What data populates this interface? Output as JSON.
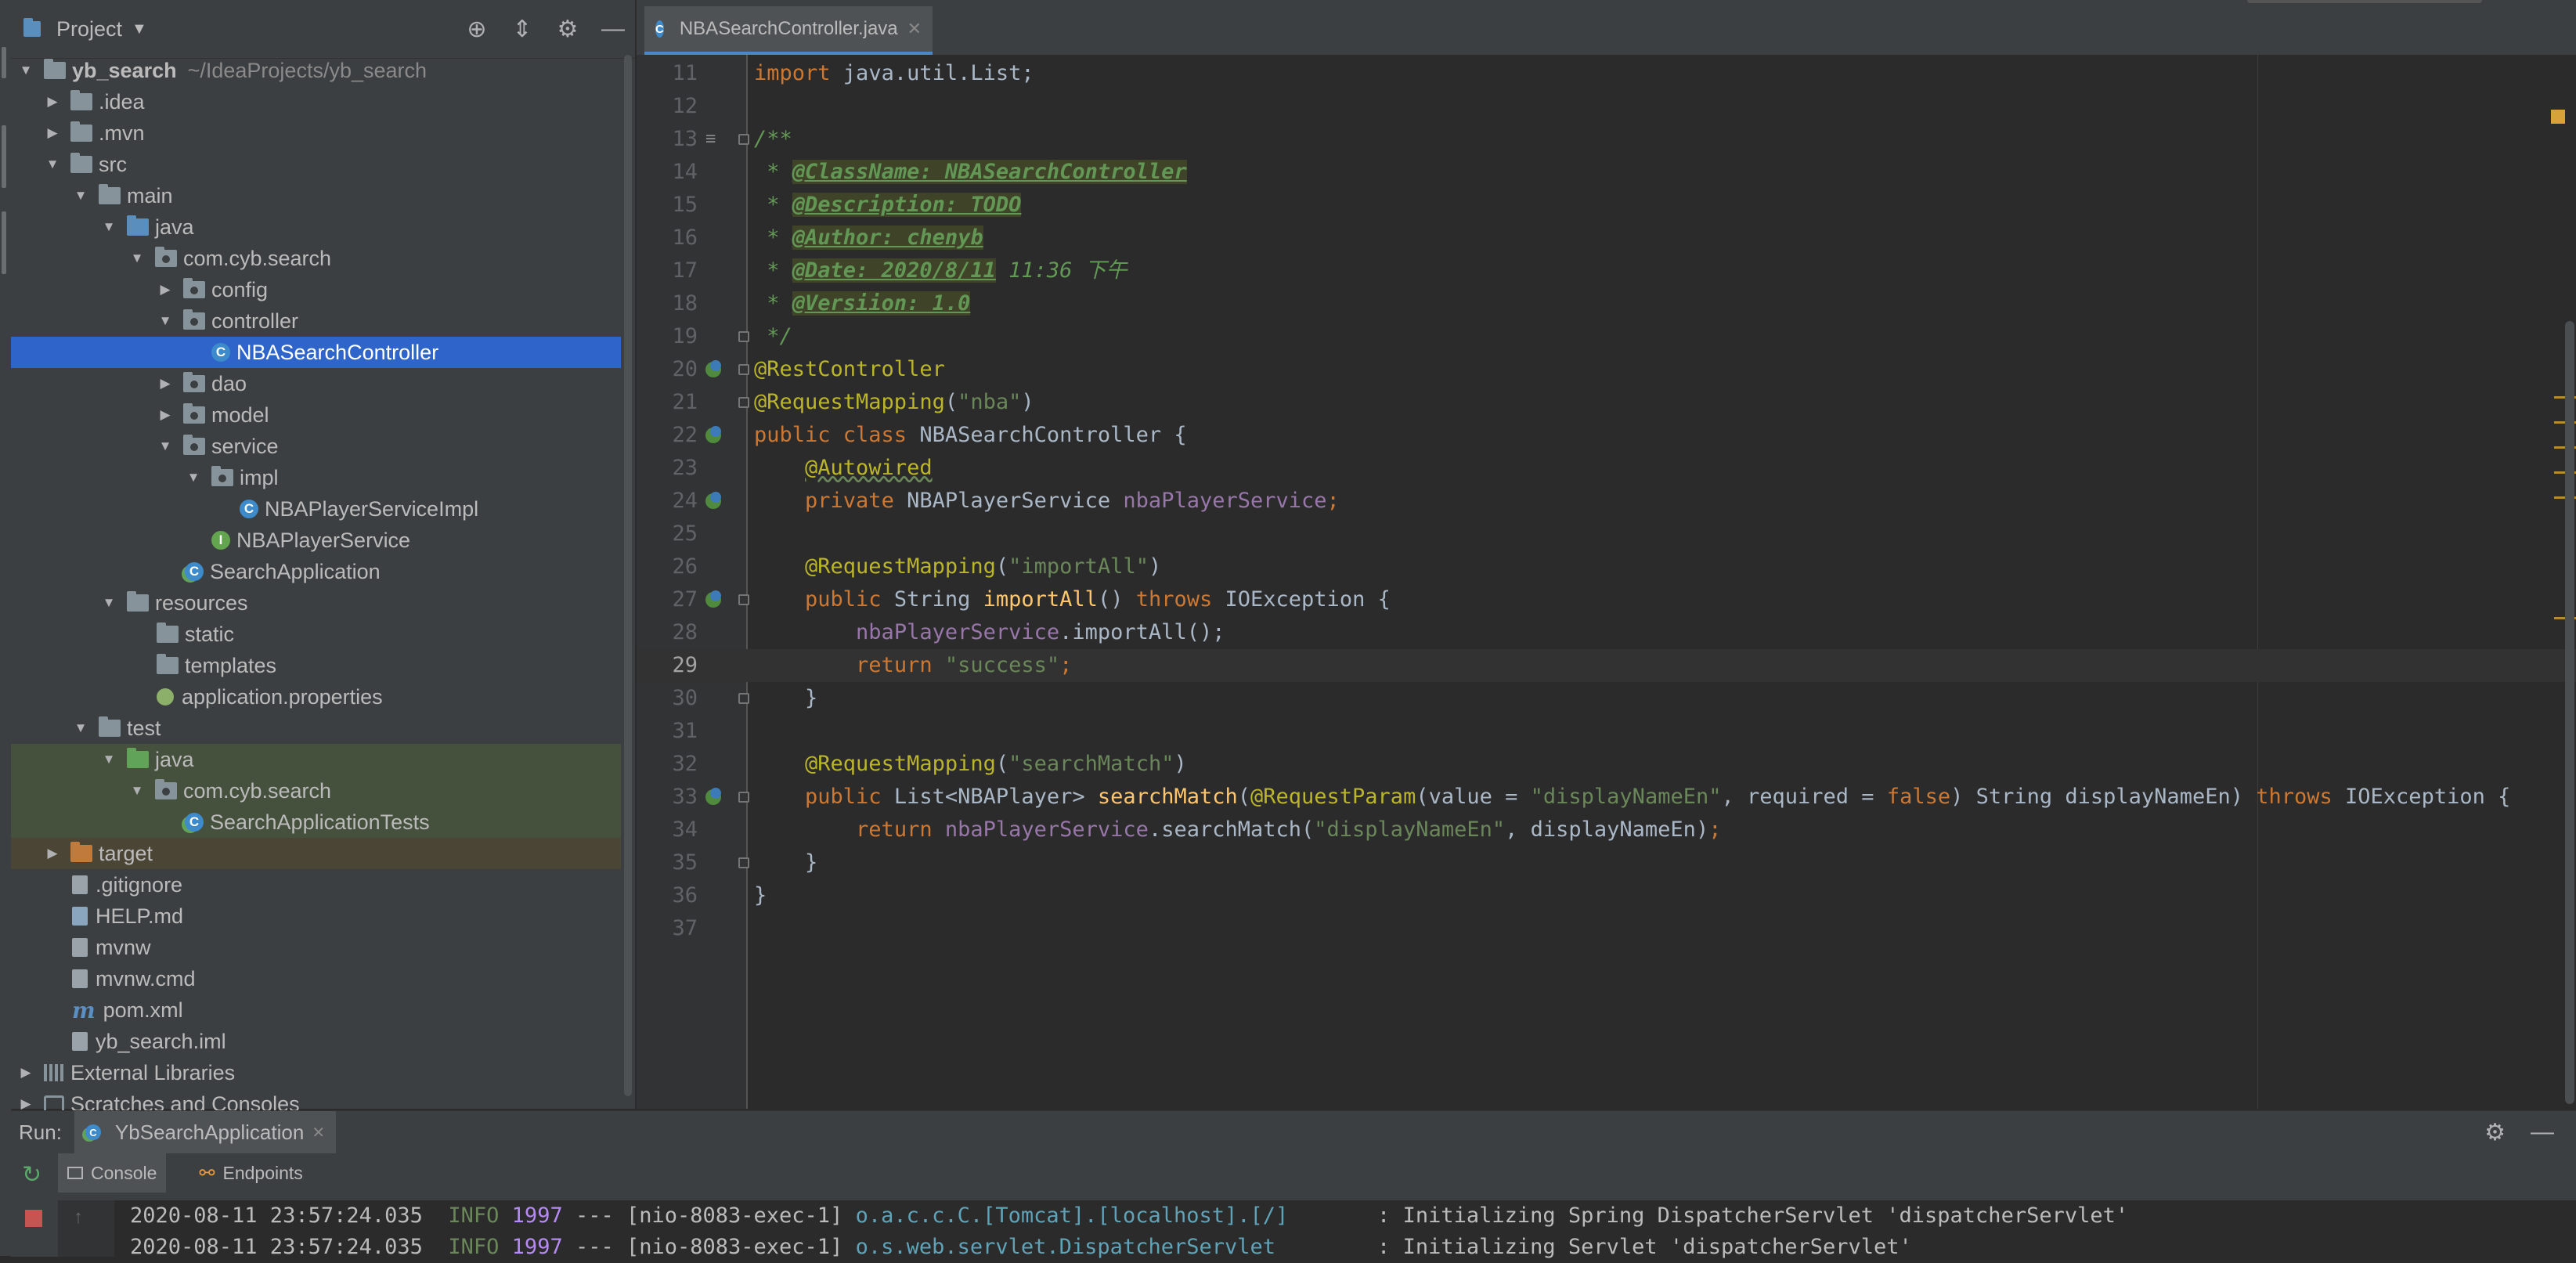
{
  "project_panel": {
    "title": "Project",
    "tree": [
      {
        "label": "yb_search",
        "hint": "~/IdeaProjects/yb_search"
      },
      {
        "label": ".idea"
      },
      {
        "label": ".mvn"
      },
      {
        "label": "src"
      },
      {
        "label": "main"
      },
      {
        "label": "java"
      },
      {
        "label": "com.cyb.search"
      },
      {
        "label": "config"
      },
      {
        "label": "controller"
      },
      {
        "label": "NBASearchController"
      },
      {
        "label": "dao"
      },
      {
        "label": "model"
      },
      {
        "label": "service"
      },
      {
        "label": "impl"
      },
      {
        "label": "NBAPlayerServiceImpl"
      },
      {
        "label": "NBAPlayerService"
      },
      {
        "label": "SearchApplication"
      },
      {
        "label": "resources"
      },
      {
        "label": "static"
      },
      {
        "label": "templates"
      },
      {
        "label": "application.properties"
      },
      {
        "label": "test"
      },
      {
        "label": "java"
      },
      {
        "label": "com.cyb.search"
      },
      {
        "label": "SearchApplicationTests"
      },
      {
        "label": "target"
      },
      {
        "label": ".gitignore"
      },
      {
        "label": "HELP.md"
      },
      {
        "label": "mvnw"
      },
      {
        "label": "mvnw.cmd"
      },
      {
        "label": "pom.xml"
      },
      {
        "label": "yb_search.iml"
      },
      {
        "label": "External Libraries"
      },
      {
        "label": "Scratches and Consoles"
      }
    ],
    "selected": "NBASearchController"
  },
  "editor": {
    "tab": "NBASearchController.java",
    "current_line": 29,
    "line_numbers": [
      "11",
      "12",
      "13",
      "14",
      "15",
      "16",
      "17",
      "18",
      "19",
      "20",
      "21",
      "22",
      "23",
      "24",
      "25",
      "26",
      "27",
      "28",
      "29",
      "30",
      "31",
      "32",
      "33",
      "34",
      "35",
      "36",
      "37"
    ],
    "code": {
      "l11a": "import",
      "l11b": " java.util.List;",
      "l13": "/**",
      "l14a": " * ",
      "l14b": "@ClassName: NBASearchController",
      "l15a": " * ",
      "l15b": "@Description: TODO",
      "l16a": " * ",
      "l16b": "@Author: chenyb",
      "l17a": " * ",
      "l17b": "@Date: 2020/8/11",
      "l17c": " 11:36 下午",
      "l18a": " * ",
      "l18b": "@Versiion: 1.0",
      "l19": " */",
      "l20": "@RestController",
      "l21a": "@RequestMapping",
      "l21b": "(",
      "l21c": "\"nba\"",
      "l21d": ")",
      "l22a": "public class ",
      "l22b": "NBASearchController {",
      "l23": "@Autowired",
      "l24a": "private ",
      "l24b": "NBAPlayerService ",
      "l24c": "nbaPlayerService",
      "l24d": ";",
      "l26a": "@RequestMapping",
      "l26b": "(",
      "l26c": "\"importAll\"",
      "l26d": ")",
      "l27a": "public ",
      "l27b": "String ",
      "l27c": "importAll",
      "l27d": "() ",
      "l27e": "throws ",
      "l27f": "IOException {",
      "l28a": "nbaPlayerService",
      "l28b": ".importAll();",
      "l29a": "return ",
      "l29b": "\"success\"",
      "l29c": ";",
      "l30": "}",
      "l32a": "@RequestMapping",
      "l32b": "(",
      "l32c": "\"searchMatch\"",
      "l32d": ")",
      "l33a": "public ",
      "l33b": "List<NBAPlayer> ",
      "l33c": "searchMatch",
      "l33d": "(",
      "l33e": "@RequestParam",
      "l33f": "(value = ",
      "l33g": "\"displayNameEn\"",
      "l33h": ", required = ",
      "l33i": "false",
      "l33j": ") String displayNameEn) ",
      "l33k": "throws ",
      "l33l": "IOException {",
      "l34a": "return ",
      "l34b": "nbaPlayerService",
      "l34c": ".searchMatch(",
      "l34d": "\"displayNameEn\"",
      "l34e": ", displayNameEn)",
      "l34f": ";",
      "l35": "}",
      "l36": "}"
    }
  },
  "run_panel": {
    "label": "Run:",
    "config": "YbSearchApplication",
    "tabs": [
      "Console",
      "Endpoints"
    ],
    "log": [
      {
        "time": "2020-08-11 23:57:24.035  ",
        "level": "INFO",
        "pid": " 1997",
        "sep": " --- [nio-8083-exec-1] ",
        "logger": "o.a.c.c.C.[Tomcat].[localhost].[/]",
        "msg": "       : Initializing Spring DispatcherServlet 'dispatcherServlet'"
      },
      {
        "time": "2020-08-11 23:57:24.035  ",
        "level": "INFO",
        "pid": " 1997",
        "sep": " --- [nio-8083-exec-1] ",
        "logger": "o.s.web.servlet.DispatcherServlet",
        "msg": "        : Initializing Servlet 'dispatcherServlet'"
      }
    ]
  }
}
